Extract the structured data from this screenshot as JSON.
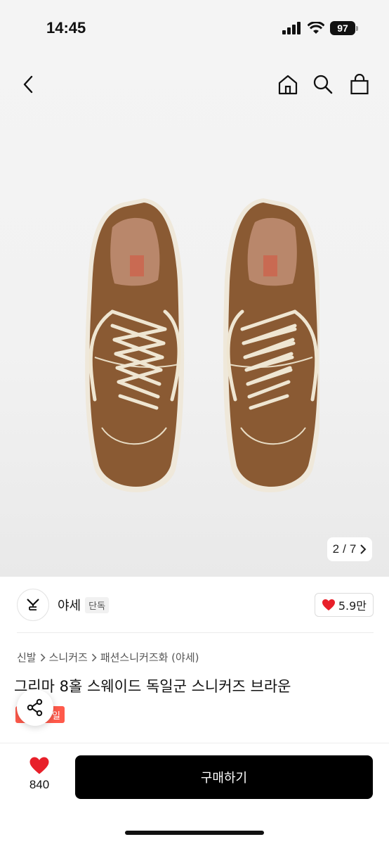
{
  "status": {
    "time": "14:45",
    "battery": "97"
  },
  "nav": {
    "back_icon": "chevron-left-icon",
    "home_icon": "home-icon",
    "search_icon": "search-icon",
    "bag_icon": "shopping-bag-icon"
  },
  "gallery": {
    "current": "2",
    "separator": "/",
    "total": "7",
    "next_icon": "chevron-right-icon"
  },
  "seller": {
    "name": "야세",
    "badge": "단독",
    "likes": "5.9만",
    "logo_text": "YSE"
  },
  "breadcrumb": [
    "신발",
    "스니커즈",
    "패션스니커즈화 (야세)"
  ],
  "product": {
    "title": "그리마 8홀 스웨이드 독일군 스니커즈 브라운",
    "tag": "일"
  },
  "bottom": {
    "wish_count": "840",
    "buy_label": "구매하기"
  },
  "colors": {
    "accent": "#ff5a4b",
    "heart": "#e8202a",
    "button": "#000000",
    "suede": "#8a5a33"
  }
}
